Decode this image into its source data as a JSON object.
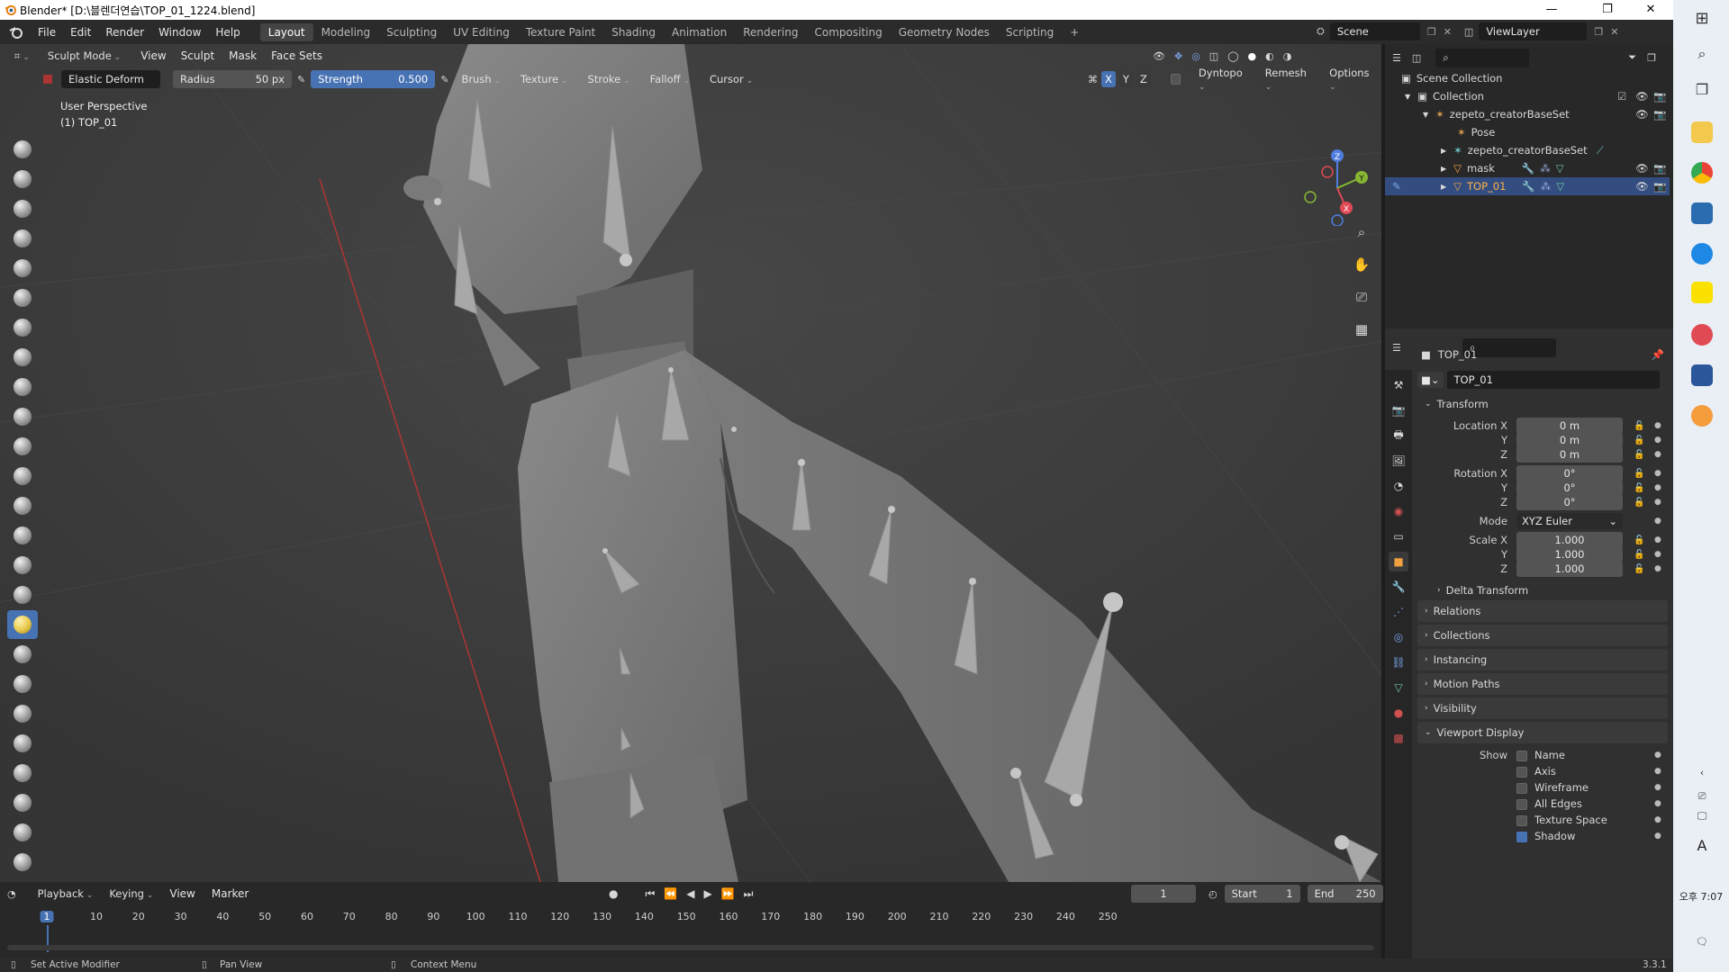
{
  "window": {
    "title": "Blender* [D:\\블렌더연습\\TOP_01_1224.blend]",
    "minimize": "—",
    "maximize": "❐",
    "close": "✕"
  },
  "menus": [
    "File",
    "Edit",
    "Render",
    "Window",
    "Help"
  ],
  "workspaces": [
    "Layout",
    "Modeling",
    "Sculpting",
    "UV Editing",
    "Texture Paint",
    "Shading",
    "Animation",
    "Rendering",
    "Compositing",
    "Geometry Nodes",
    "Scripting",
    "+"
  ],
  "active_workspace": "Layout",
  "scene": {
    "label": "Scene",
    "view_layer": "ViewLayer"
  },
  "viewport_header": {
    "mode": "Sculpt Mode",
    "menus": [
      "View",
      "Sculpt",
      "Mask",
      "Face Sets"
    ]
  },
  "tool_settings": {
    "brush_name": "Elastic Deform",
    "radius_label": "Radius",
    "radius_value": "50 px",
    "strength_label": "Strength",
    "strength_value": "0.500",
    "dropdowns": [
      "Brush",
      "Texture",
      "Stroke",
      "Falloff",
      "Cursor"
    ],
    "axes": [
      "X",
      "Y",
      "Z"
    ],
    "right": [
      "Dyntopo",
      "Remesh",
      "Options"
    ]
  },
  "viewport_overlay": {
    "perspective": "User Perspective",
    "object": "(1) TOP_01"
  },
  "gizmo": {
    "x": "X",
    "y": "Y",
    "z": "Z"
  },
  "outliner": {
    "rows": [
      {
        "label": "Scene Collection"
      },
      {
        "label": "Collection"
      },
      {
        "label": "zepeto_creatorBaseSet"
      },
      {
        "label": "Pose"
      },
      {
        "label": "zepeto_creatorBaseSet"
      },
      {
        "label": "mask"
      },
      {
        "label": "TOP_01"
      }
    ]
  },
  "properties": {
    "object_name": "TOP_01",
    "datablock": "TOP_01",
    "transform": {
      "header": "Transform",
      "location": {
        "label": "Location X",
        "x": "0 m",
        "y": "0 m",
        "z": "0 m"
      },
      "rotation": {
        "label": "Rotation X",
        "x": "0°",
        "y": "0°",
        "z": "0°"
      },
      "mode": {
        "label": "Mode",
        "value": "XYZ Euler"
      },
      "scale": {
        "label": "Scale X",
        "x": "1.000",
        "y": "1.000",
        "z": "1.000"
      },
      "axis_y": "Y",
      "axis_z": "Z",
      "delta": "Delta Transform"
    },
    "sections": [
      "Relations",
      "Collections",
      "Instancing",
      "Motion Paths",
      "Visibility",
      "Viewport Display"
    ],
    "viewport_display": {
      "show_label": "Show",
      "options": [
        {
          "label": "Name",
          "checked": false
        },
        {
          "label": "Axis",
          "checked": false
        },
        {
          "label": "Wireframe",
          "checked": false
        },
        {
          "label": "All Edges",
          "checked": false
        },
        {
          "label": "Texture Space",
          "checked": false
        },
        {
          "label": "Shadow",
          "checked": true
        }
      ]
    }
  },
  "timeline": {
    "menus": [
      "Playback",
      "Keying",
      "View",
      "Marker"
    ],
    "current_frame": "1",
    "start_label": "Start",
    "start": "1",
    "end_label": "End",
    "end": "250",
    "ticks": [
      "1",
      "10",
      "20",
      "30",
      "40",
      "50",
      "60",
      "70",
      "80",
      "90",
      "100",
      "110",
      "120",
      "130",
      "140",
      "150",
      "160",
      "170",
      "180",
      "190",
      "200",
      "210",
      "220",
      "230",
      "240",
      "250"
    ]
  },
  "statusbar": {
    "left": "Set Active Modifier",
    "mid": "Pan View",
    "right": "Context Menu",
    "version": "3.3.1"
  },
  "taskbar": {
    "time_period": "오후",
    "time": "7:07",
    "ime": "A"
  }
}
